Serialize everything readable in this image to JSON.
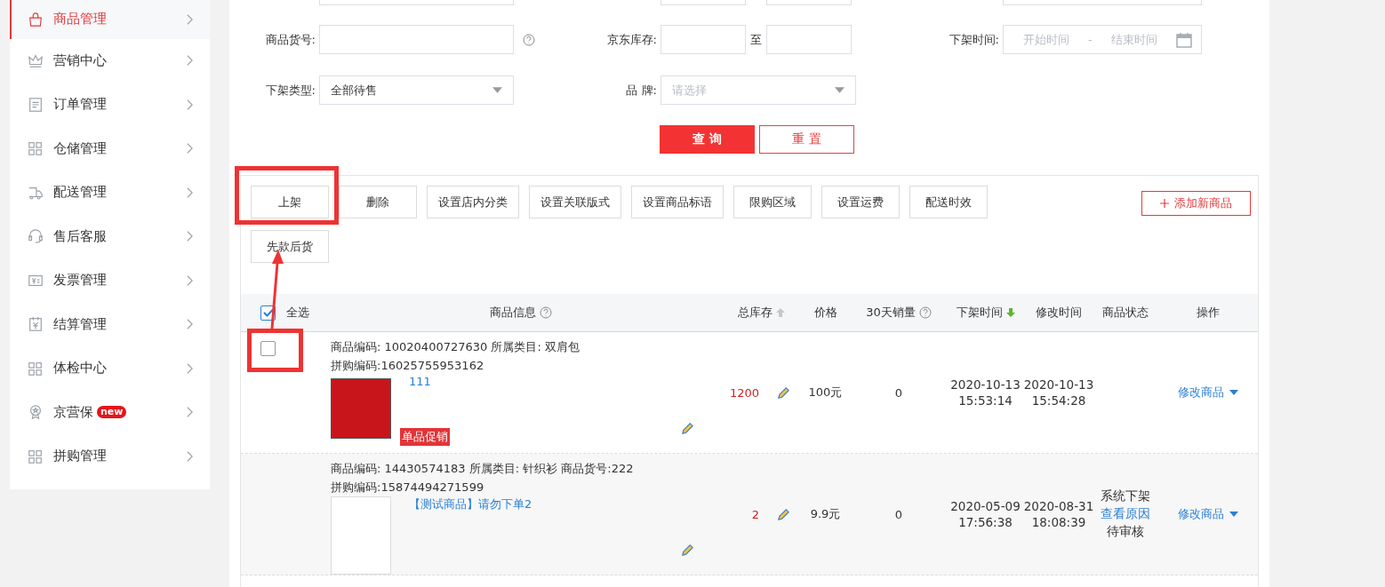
{
  "sidebar": {
    "items": [
      {
        "label": "商品管理",
        "selected": true
      },
      {
        "label": "营销中心",
        "selected": false
      },
      {
        "label": "订单管理",
        "selected": false
      },
      {
        "label": "仓储管理",
        "selected": false
      },
      {
        "label": "配送管理",
        "selected": false
      },
      {
        "label": "售后客服",
        "selected": false
      },
      {
        "label": "发票管理",
        "selected": false
      },
      {
        "label": "结算管理",
        "selected": false
      },
      {
        "label": "体检中心",
        "selected": false
      },
      {
        "label": "京营保",
        "selected": false,
        "badge": "new"
      },
      {
        "label": "拼购管理",
        "selected": false
      }
    ]
  },
  "filters": {
    "sku_label": "商品货号:",
    "stock_label": "京东库存:",
    "stock_to": "至",
    "offshelf_time_label": "下架时间:",
    "start_placeholder": "开始时间",
    "range_separator": "-",
    "end_placeholder": "结束时间",
    "offshelf_type_label": "下架类型:",
    "offshelf_type_value": "全部待售",
    "brand_label": "品 牌:",
    "brand_placeholder": "请选择",
    "query_button": "查 询",
    "reset_button": "重 置"
  },
  "toolbar": {
    "buttons": [
      "上架",
      "删除",
      "设置店内分类",
      "设置关联版式",
      "设置商品标语",
      "限购区域",
      "设置运费",
      "配送时效",
      "先款后货"
    ],
    "add_button": "添加新商品"
  },
  "table": {
    "select_all": {
      "label": "全选",
      "checked": true
    },
    "columns": [
      "商品信息",
      "总库存",
      "价格",
      "30天销量",
      "下架时间",
      "修改时间",
      "商品状态",
      "操作"
    ],
    "rows": [
      {
        "checked": false,
        "code_line": "商品编码:   10020400727630 所属类目: 双肩包",
        "group_code": "拼购编码:16025755953162",
        "title": "111",
        "tag": "单品促销",
        "stock": "1200",
        "price": "100元",
        "sales": "0",
        "offshelf_date": "2020-10-13",
        "offshelf_time": "15:53:14",
        "modified_date": "2020-10-13",
        "modified_time": "15:54:28",
        "status": [],
        "action": "修改商品"
      },
      {
        "code_line": "商品编码:   14430574183 所属类目: 针织衫 商品货号:222",
        "group_code": "拼购编码:15874494271599",
        "title": "【测试商品】请勿下单2",
        "stock": "2",
        "price": "9.9元",
        "sales": "0",
        "offshelf_date": "2020-05-09",
        "offshelf_time": "17:56:38",
        "modified_date": "2020-08-31",
        "modified_time": "18:08:39",
        "status": [
          {
            "text": "系统下架",
            "kind": "plain"
          },
          {
            "text": "查看原因",
            "kind": "link"
          },
          {
            "text": "待审核",
            "kind": "plain"
          }
        ],
        "action": "修改商品"
      }
    ]
  }
}
